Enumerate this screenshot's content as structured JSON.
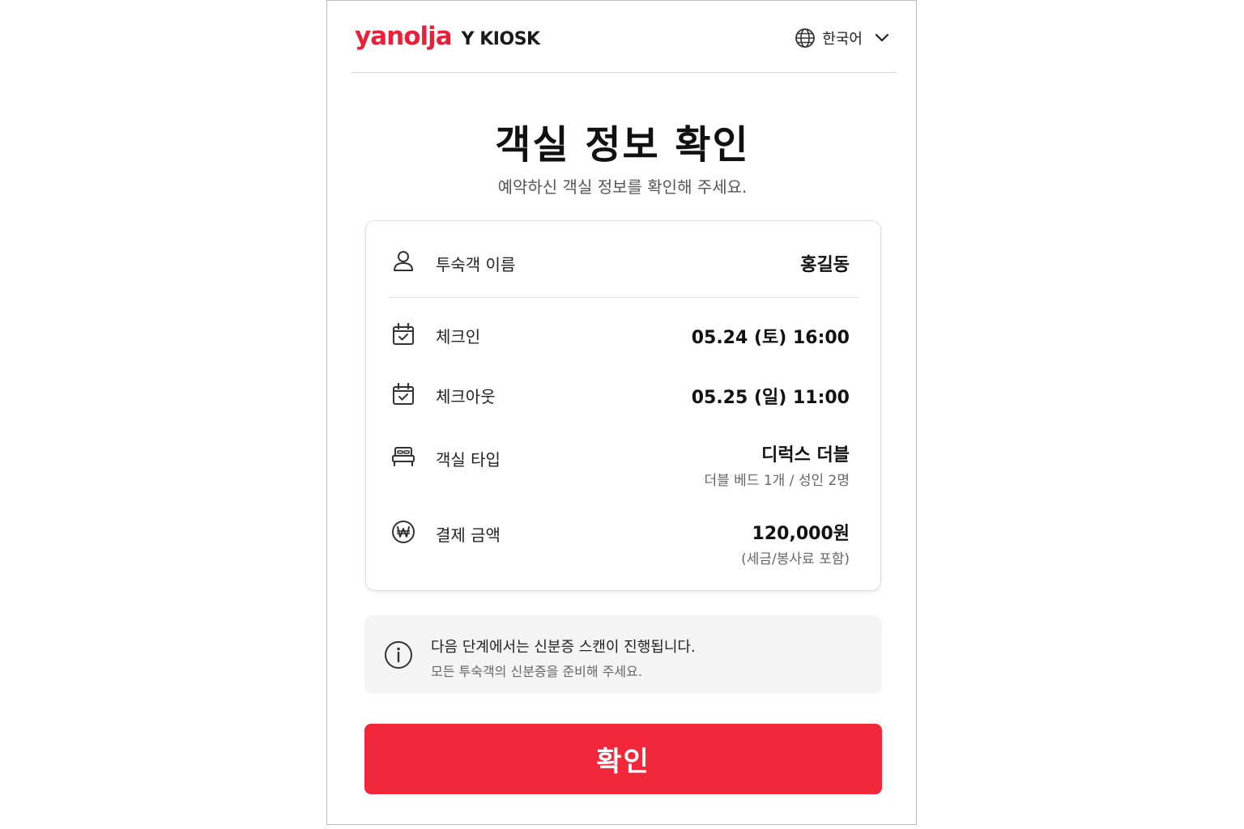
{
  "header": {
    "brand_logo": "yanolja",
    "brand_product": "Y KIOSK",
    "language_label": "한국어",
    "language_icon": "globe-icon",
    "dropdown_icon": "chevron-down-icon"
  },
  "main": {
    "title": "객실 정보 확인",
    "subtitle": "예약하신 객실 정보를 확인해 주세요."
  },
  "details": {
    "guest_name": {
      "icon": "user-icon",
      "label": "투숙객 이름",
      "value": "홍길동"
    },
    "check_in": {
      "icon": "calendar-check-icon",
      "label": "체크인",
      "value": "05.24 (토) 16:00"
    },
    "check_out": {
      "icon": "calendar-check-icon",
      "label": "체크아웃",
      "value": "05.25 (일) 11:00"
    },
    "room_type": {
      "icon": "bed-icon",
      "label": "객실 타입",
      "value": "디럭스 더블",
      "subvalue": "더블 베드 1개 / 성인 2명"
    },
    "payment": {
      "icon": "won-icon",
      "label": "결제 금액",
      "value": "120,000원",
      "subvalue": "(세금/봉사료 포함)"
    }
  },
  "notice": {
    "icon": "info-icon",
    "title": "다음 단계에서는 신분증 스캔이 진행됩니다.",
    "text": "모든 투숙객의 신분증을 준비해 주세요."
  },
  "actions": {
    "confirm_label": "확인"
  },
  "colors": {
    "brand": "#e8203a",
    "button": "#f2283a",
    "notice_bg": "#f4f4f4"
  }
}
